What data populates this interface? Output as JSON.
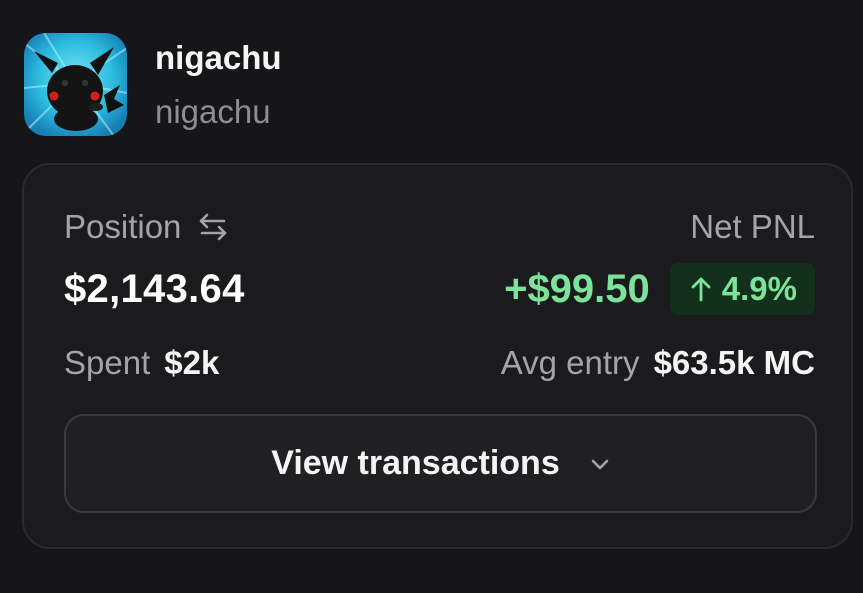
{
  "token": {
    "name": "nigachu",
    "handle": "nigachu",
    "avatar_icon": "black-pikachu-avatar"
  },
  "position": {
    "label": "Position",
    "swap_icon": "swap-arrows-icon",
    "value": "$2,143.64"
  },
  "pnl": {
    "label": "Net PNL",
    "value": "+$99.50",
    "percent": "4.9%",
    "direction_icon": "arrow-up-icon"
  },
  "spent": {
    "label": "Spent",
    "value": "$2k"
  },
  "avg_entry": {
    "label": "Avg entry",
    "value": "$63.5k MC"
  },
  "actions": {
    "view_transactions_label": "View transactions",
    "chevron_icon": "chevron-down-icon"
  },
  "colors": {
    "background": "#161618",
    "card": "#1b1b1e",
    "positive": "#7be39a",
    "positive_badge_bg": "#13301c",
    "muted_text": "#a3a3a9"
  }
}
